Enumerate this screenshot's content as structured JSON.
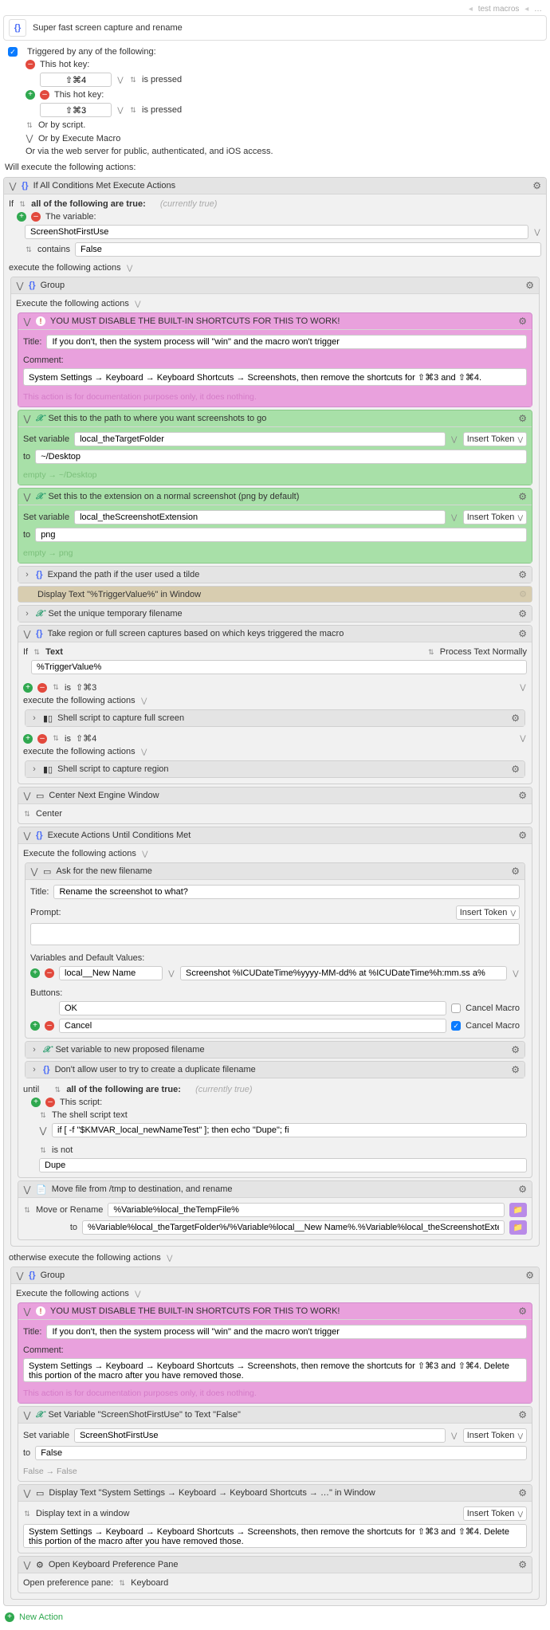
{
  "crumb": {
    "parent": "test macros",
    "current": "…"
  },
  "title": "Super fast screen capture and rename",
  "triggers": {
    "heading": "Triggered by any of the following:",
    "hotkey_label": "This hot key:",
    "hotkey1": "⇧⌘4",
    "hotkey2": "⇧⌘3",
    "pressed": "is pressed",
    "or_script": "Or by script.",
    "or_execute": "Or by Execute Macro",
    "or_web": "Or via the web server for public, authenticated, and iOS access."
  },
  "will_execute": "Will execute the following actions:",
  "ifall": {
    "title": "If All Conditions Met Execute Actions",
    "cond_prefix": "If",
    "cond_all": "all of the following are true:",
    "cur_true": "(currently true)",
    "the_variable": "The variable:",
    "var_name": "ScreenShotFirstUse",
    "contains": "contains",
    "contains_val": "False"
  },
  "exec_following": "execute the following actions",
  "group1": {
    "title": "Group",
    "exec": "Execute the following actions"
  },
  "warn1": {
    "title": "YOU MUST DISABLE THE BUILT-IN SHORTCUTS FOR THIS TO WORK!",
    "title_label": "Title:",
    "title_val": "If you don't, then the system process will \"win\" and the macro won't trigger",
    "comment_label": "Comment:",
    "comment_val": "System Settings → Keyboard → Keyboard Shortcuts → Screenshots, then remove the shortcuts for ⇧⌘3 and ⇧⌘4.",
    "note": "This action is for documentation purposes only, it does nothing."
  },
  "setvar1": {
    "title": "Set this to the path to where you want screenshots to go",
    "set_label": "Set variable",
    "var": "local_theTargetFolder",
    "insert": "Insert Token",
    "to": "to",
    "val": "~/Desktop",
    "footer": "empty → ~/Desktop"
  },
  "setvar2": {
    "title": "Set this to the extension on a normal screenshot (png by default)",
    "var": "local_theScreenshotExtension",
    "val": "png",
    "footer": "empty → png"
  },
  "expand": {
    "title": "Expand the path if the user used a tilde"
  },
  "display_trigger": "Display Text \"%TriggerValue%\" in Window",
  "set_unique": "Set the unique temporary filename",
  "take": {
    "title": "Take region or full screen captures based on which keys triggered the macro",
    "if_text": "If",
    "text_label": "Text",
    "process": "Process Text Normally",
    "trigger_val": "%TriggerValue%",
    "is": "is",
    "v3": "⇧⌘3",
    "v4": "⇧⌘4",
    "full": "Shell script to capture full screen",
    "region": "Shell script to capture region"
  },
  "center": {
    "title": "Center Next Engine Window",
    "label": "Center"
  },
  "loop": {
    "title": "Execute Actions Until Conditions Met",
    "exec": "Execute the following actions",
    "ask_title": "Ask for the new filename",
    "prompt_title_label": "Title:",
    "prompt_title": "Rename the screenshot to what?",
    "prompt_label": "Prompt:",
    "insert": "Insert Token",
    "vars_label": "Variables and Default Values:",
    "var_name": "local__New Name",
    "var_default": "Screenshot %ICUDateTime%yyyy-MM-dd% at %ICUDateTime%h:mm.ss a%",
    "buttons_label": "Buttons:",
    "ok": "OK",
    "cancel": "Cancel",
    "cancel_macro": "Cancel Macro",
    "set_new": "Set variable to new proposed filename",
    "no_dup": "Don't allow user to try to create a duplicate filename",
    "until": "until",
    "all_true": "all of the following are true:",
    "cur_true": "(currently true)",
    "this_script": "This script:",
    "shell_text": "The shell script text",
    "script": "if [ -f \"$KMVAR_local_newNameTest\" ]; then echo \"Dupe\"; fi",
    "is_not": "is not",
    "dupe": "Dupe"
  },
  "move": {
    "title": "Move file from /tmp to destination, and rename",
    "label": "Move or Rename",
    "src": "%Variable%local_theTempFile%",
    "to": "to",
    "dst": "%Variable%local_theTargetFolder%/%Variable%local__New Name%.%Variable%local_theScreenshotExtension%"
  },
  "otherwise": "otherwise execute the following actions",
  "warn2": {
    "comment_val": "System Settings → Keyboard → Keyboard Shortcuts → Screenshots, then remove the shortcuts for ⇧⌘3 and ⇧⌘4. Delete this portion of the macro after you have removed those."
  },
  "setvar3": {
    "title": "Set Variable \"ScreenShotFirstUse\" to Text \"False\"",
    "var": "ScreenShotFirstUse",
    "val": "False",
    "footer": "False → False"
  },
  "display2": {
    "title": "Display Text \"System Settings → Keyboard → Keyboard Shortcuts → …\" in Window",
    "label": "Display text in a window",
    "val": "System Settings → Keyboard → Keyboard Shortcuts → Screenshots, then remove the shortcuts for ⇧⌘3 and ⇧⌘4. Delete this portion of the macro after you have removed those."
  },
  "openpref": {
    "title": "Open Keyboard Preference Pane",
    "label": "Open preference pane:",
    "val": "Keyboard"
  },
  "new_action": "New Action"
}
